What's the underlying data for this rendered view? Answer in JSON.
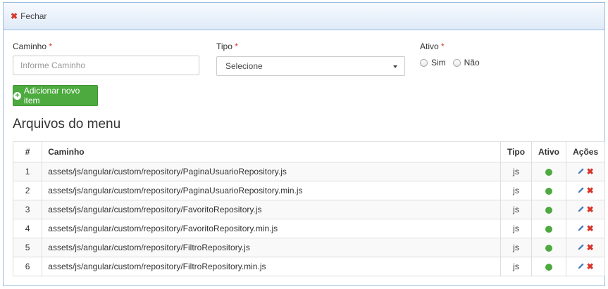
{
  "topbar": {
    "close_label": "Fechar"
  },
  "form": {
    "caminho": {
      "label": "Caminho",
      "placeholder": "Informe Caminho"
    },
    "tipo": {
      "label": "Tipo",
      "selected": "Selecione"
    },
    "ativo": {
      "label": "Ativo",
      "options": [
        "Sim",
        "Não"
      ]
    },
    "required_mark": "*"
  },
  "add_button": {
    "label": "Adicionar novo item"
  },
  "section_title": "Arquivos do menu",
  "table": {
    "headers": [
      "#",
      "Caminho",
      "Tipo",
      "Ativo",
      "Ações"
    ],
    "rows": [
      {
        "num": "1",
        "path": "assets/js/angular/custom/repository/PaginaUsuarioRepository.js",
        "tipo": "js"
      },
      {
        "num": "2",
        "path": "assets/js/angular/custom/repository/PaginaUsuarioRepository.min.js",
        "tipo": "js"
      },
      {
        "num": "3",
        "path": "assets/js/angular/custom/repository/FavoritoRepository.js",
        "tipo": "js"
      },
      {
        "num": "4",
        "path": "assets/js/angular/custom/repository/FavoritoRepository.min.js",
        "tipo": "js"
      },
      {
        "num": "5",
        "path": "assets/js/angular/custom/repository/FiltroRepository.js",
        "tipo": "js"
      },
      {
        "num": "6",
        "path": "assets/js/angular/custom/repository/FiltroRepository.min.js",
        "tipo": "js"
      }
    ]
  },
  "colors": {
    "accent_green": "#4caa3e",
    "danger_red": "#d9352b",
    "edit_blue": "#3a78c3",
    "topbar_border": "#9bbbe0"
  },
  "icons": {
    "close": "close-icon",
    "add": "plus-circle-icon",
    "active": "active-dot-icon",
    "edit": "pencil-icon",
    "delete": "delete-icon"
  }
}
